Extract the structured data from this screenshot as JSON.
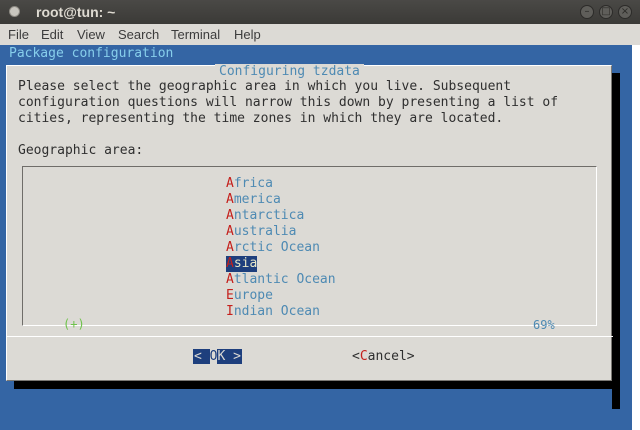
{
  "window": {
    "title": "root@tun: ~"
  },
  "menu": [
    "File",
    "Edit",
    "View",
    "Search",
    "Terminal",
    "Help"
  ],
  "terminal": {
    "header": "Package configuration"
  },
  "dialog": {
    "title": "Configuring tzdata",
    "text_lines": [
      "Please select the geographic area in which you live. Subsequent",
      "configuration questions will narrow this down by presenting a list of",
      "cities, representing the time zones in which they are located."
    ],
    "area_label": "Geographic area:",
    "items": [
      {
        "hot": "A",
        "rest": "frica"
      },
      {
        "hot": "A",
        "rest": "merica"
      },
      {
        "hot": "A",
        "rest": "ntarctica"
      },
      {
        "hot": "A",
        "rest": "ustralia"
      },
      {
        "hot": "A",
        "rest": "rctic Ocean"
      },
      {
        "hot": "A",
        "rest": "sia"
      },
      {
        "hot": "A",
        "rest": "tlantic Ocean"
      },
      {
        "hot": "E",
        "rest": "urope"
      },
      {
        "hot": "I",
        "rest": "ndian Ocean"
      }
    ],
    "selected_item": "Asia",
    "scroll_indicator": "(+)",
    "scroll_percent": "69%",
    "ok_button": {
      "left": "< ",
      "hot": "O",
      "rest": "K >"
    },
    "cancel_button": {
      "left": "<",
      "hot": "C",
      "rest": "ancel>"
    }
  },
  "colors": {
    "terminal_bg": "#3465a4",
    "dialog_bg": "#dcdad5",
    "hotkey": "#c4201c",
    "item_text": "#4e8ab3",
    "selection_bg": "#1e3f7d"
  }
}
